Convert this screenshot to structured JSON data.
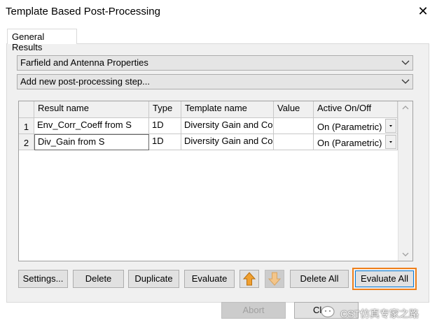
{
  "window": {
    "title": "Template Based Post-Processing"
  },
  "tabs": [
    {
      "label": "General Results"
    }
  ],
  "combos": {
    "category": "Farfield and Antenna Properties",
    "add_step": "Add new post-processing step..."
  },
  "table": {
    "columns": [
      "Result name",
      "Type",
      "Template name",
      "Value",
      "Active On/Off"
    ],
    "rows": [
      {
        "num": "1",
        "result_name": "Env_Corr_Coeff from S",
        "type": "1D",
        "template": "Diversity Gain and Corre",
        "value": "",
        "active": "On (Parametric)"
      },
      {
        "num": "2",
        "result_name": "Div_Gain from S",
        "type": "1D",
        "template": "Diversity Gain and Corre",
        "value": "",
        "active": "On (Parametric)"
      }
    ]
  },
  "buttons": {
    "settings": "Settings...",
    "delete": "Delete",
    "duplicate": "Duplicate",
    "evaluate": "Evaluate",
    "delete_all": "Delete All",
    "evaluate_all": "Evaluate All",
    "abort": "Abort",
    "close": "Cl"
  },
  "watermark": "CST仿真专家之路",
  "colors": {
    "focus": "#ef7f1a",
    "arrow_up": "#f0a030",
    "arrow_down": "#f3c58a"
  }
}
